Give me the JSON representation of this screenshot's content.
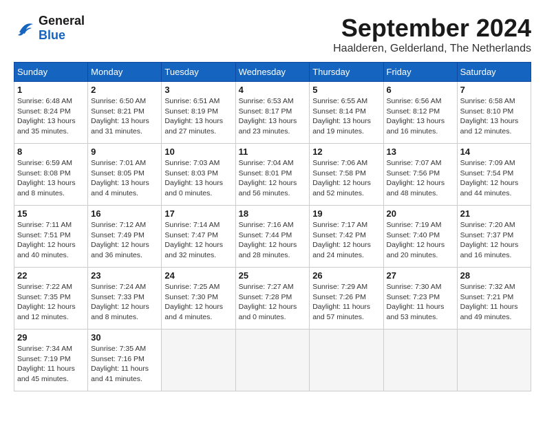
{
  "logo": {
    "line1": "General",
    "line2": "Blue"
  },
  "title": "September 2024",
  "location": "Haalderen, Gelderland, The Netherlands",
  "weekdays": [
    "Sunday",
    "Monday",
    "Tuesday",
    "Wednesday",
    "Thursday",
    "Friday",
    "Saturday"
  ],
  "weeks": [
    [
      {
        "day": "1",
        "info": "Sunrise: 6:48 AM\nSunset: 8:24 PM\nDaylight: 13 hours\nand 35 minutes."
      },
      {
        "day": "2",
        "info": "Sunrise: 6:50 AM\nSunset: 8:21 PM\nDaylight: 13 hours\nand 31 minutes."
      },
      {
        "day": "3",
        "info": "Sunrise: 6:51 AM\nSunset: 8:19 PM\nDaylight: 13 hours\nand 27 minutes."
      },
      {
        "day": "4",
        "info": "Sunrise: 6:53 AM\nSunset: 8:17 PM\nDaylight: 13 hours\nand 23 minutes."
      },
      {
        "day": "5",
        "info": "Sunrise: 6:55 AM\nSunset: 8:14 PM\nDaylight: 13 hours\nand 19 minutes."
      },
      {
        "day": "6",
        "info": "Sunrise: 6:56 AM\nSunset: 8:12 PM\nDaylight: 13 hours\nand 16 minutes."
      },
      {
        "day": "7",
        "info": "Sunrise: 6:58 AM\nSunset: 8:10 PM\nDaylight: 13 hours\nand 12 minutes."
      }
    ],
    [
      {
        "day": "8",
        "info": "Sunrise: 6:59 AM\nSunset: 8:08 PM\nDaylight: 13 hours\nand 8 minutes."
      },
      {
        "day": "9",
        "info": "Sunrise: 7:01 AM\nSunset: 8:05 PM\nDaylight: 13 hours\nand 4 minutes."
      },
      {
        "day": "10",
        "info": "Sunrise: 7:03 AM\nSunset: 8:03 PM\nDaylight: 13 hours\nand 0 minutes."
      },
      {
        "day": "11",
        "info": "Sunrise: 7:04 AM\nSunset: 8:01 PM\nDaylight: 12 hours\nand 56 minutes."
      },
      {
        "day": "12",
        "info": "Sunrise: 7:06 AM\nSunset: 7:58 PM\nDaylight: 12 hours\nand 52 minutes."
      },
      {
        "day": "13",
        "info": "Sunrise: 7:07 AM\nSunset: 7:56 PM\nDaylight: 12 hours\nand 48 minutes."
      },
      {
        "day": "14",
        "info": "Sunrise: 7:09 AM\nSunset: 7:54 PM\nDaylight: 12 hours\nand 44 minutes."
      }
    ],
    [
      {
        "day": "15",
        "info": "Sunrise: 7:11 AM\nSunset: 7:51 PM\nDaylight: 12 hours\nand 40 minutes."
      },
      {
        "day": "16",
        "info": "Sunrise: 7:12 AM\nSunset: 7:49 PM\nDaylight: 12 hours\nand 36 minutes."
      },
      {
        "day": "17",
        "info": "Sunrise: 7:14 AM\nSunset: 7:47 PM\nDaylight: 12 hours\nand 32 minutes."
      },
      {
        "day": "18",
        "info": "Sunrise: 7:16 AM\nSunset: 7:44 PM\nDaylight: 12 hours\nand 28 minutes."
      },
      {
        "day": "19",
        "info": "Sunrise: 7:17 AM\nSunset: 7:42 PM\nDaylight: 12 hours\nand 24 minutes."
      },
      {
        "day": "20",
        "info": "Sunrise: 7:19 AM\nSunset: 7:40 PM\nDaylight: 12 hours\nand 20 minutes."
      },
      {
        "day": "21",
        "info": "Sunrise: 7:20 AM\nSunset: 7:37 PM\nDaylight: 12 hours\nand 16 minutes."
      }
    ],
    [
      {
        "day": "22",
        "info": "Sunrise: 7:22 AM\nSunset: 7:35 PM\nDaylight: 12 hours\nand 12 minutes."
      },
      {
        "day": "23",
        "info": "Sunrise: 7:24 AM\nSunset: 7:33 PM\nDaylight: 12 hours\nand 8 minutes."
      },
      {
        "day": "24",
        "info": "Sunrise: 7:25 AM\nSunset: 7:30 PM\nDaylight: 12 hours\nand 4 minutes."
      },
      {
        "day": "25",
        "info": "Sunrise: 7:27 AM\nSunset: 7:28 PM\nDaylight: 12 hours\nand 0 minutes."
      },
      {
        "day": "26",
        "info": "Sunrise: 7:29 AM\nSunset: 7:26 PM\nDaylight: 11 hours\nand 57 minutes."
      },
      {
        "day": "27",
        "info": "Sunrise: 7:30 AM\nSunset: 7:23 PM\nDaylight: 11 hours\nand 53 minutes."
      },
      {
        "day": "28",
        "info": "Sunrise: 7:32 AM\nSunset: 7:21 PM\nDaylight: 11 hours\nand 49 minutes."
      }
    ],
    [
      {
        "day": "29",
        "info": "Sunrise: 7:34 AM\nSunset: 7:19 PM\nDaylight: 11 hours\nand 45 minutes."
      },
      {
        "day": "30",
        "info": "Sunrise: 7:35 AM\nSunset: 7:16 PM\nDaylight: 11 hours\nand 41 minutes."
      },
      {
        "day": "",
        "info": ""
      },
      {
        "day": "",
        "info": ""
      },
      {
        "day": "",
        "info": ""
      },
      {
        "day": "",
        "info": ""
      },
      {
        "day": "",
        "info": ""
      }
    ]
  ]
}
